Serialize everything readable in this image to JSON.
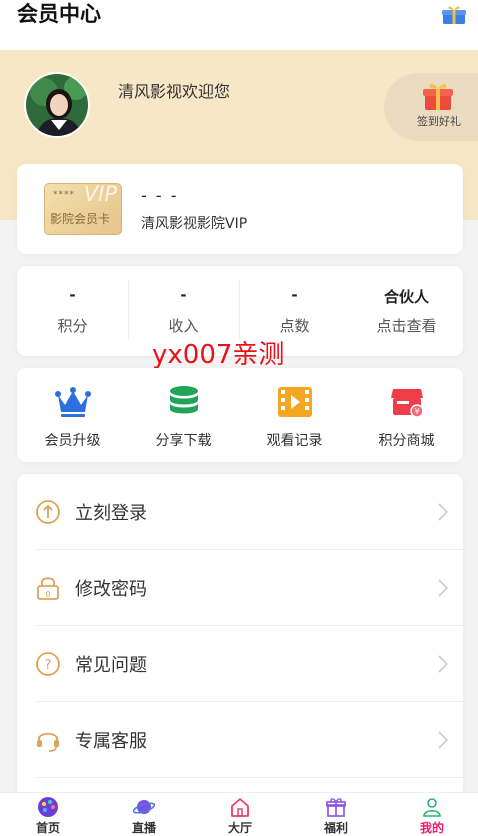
{
  "header": {
    "title": "会员中心"
  },
  "hero": {
    "welcome": "清风影视欢迎您",
    "signin_label": "签到好礼"
  },
  "vip_card": {
    "badge_stars": "****",
    "badge_word": "VIP",
    "badge_label": "影院会员卡",
    "title": "- - -",
    "subtitle": "清风影视影院VIP"
  },
  "stats": [
    {
      "value": "-",
      "label": "积分"
    },
    {
      "value": "-",
      "label": "收入"
    },
    {
      "value": "-",
      "label": "点数"
    },
    {
      "value": "合伙人",
      "label": "点击查看"
    }
  ],
  "watermark": "yx007亲测",
  "actions": [
    {
      "label": "会员升级",
      "icon": "crown-icon"
    },
    {
      "label": "分享下载",
      "icon": "database-icon"
    },
    {
      "label": "观看记录",
      "icon": "film-icon"
    },
    {
      "label": "积分商城",
      "icon": "store-icon"
    }
  ],
  "menu": [
    {
      "label": "立刻登录",
      "icon": "login-icon"
    },
    {
      "label": "修改密码",
      "icon": "lock-icon"
    },
    {
      "label": "常见问题",
      "icon": "question-icon"
    },
    {
      "label": "专属客服",
      "icon": "headset-icon"
    }
  ],
  "nav": [
    {
      "label": "首页",
      "icon": "home-palette-icon"
    },
    {
      "label": "直播",
      "icon": "planet-icon"
    },
    {
      "label": "大厅",
      "icon": "house-icon"
    },
    {
      "label": "福利",
      "icon": "gift-icon"
    },
    {
      "label": "我的",
      "icon": "user-icon",
      "active": true
    }
  ],
  "colors": {
    "accent_gold": "#e3a94a",
    "hero_bg": "#f7e7c6",
    "nav_active": "#ee1a6a",
    "watermark_red": "#e8131a"
  }
}
